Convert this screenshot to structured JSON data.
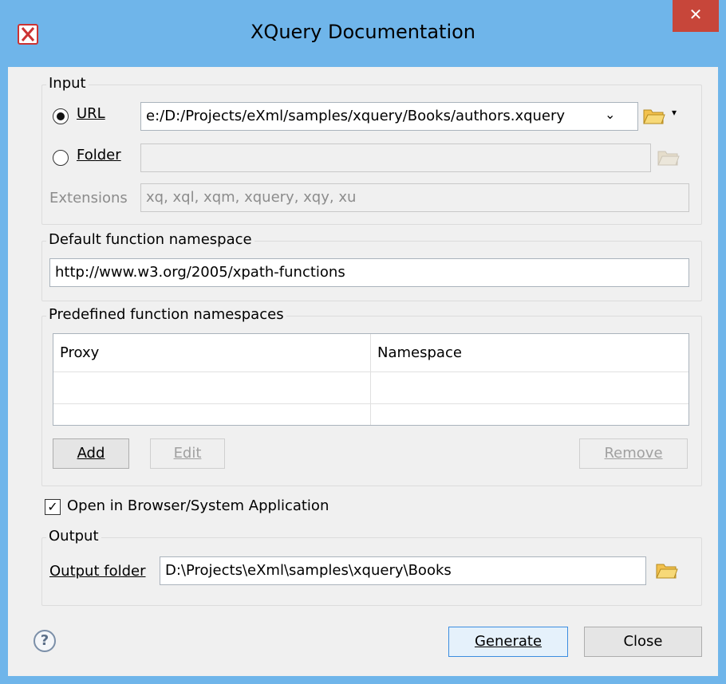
{
  "window": {
    "title": "XQuery Documentation",
    "close_glyph": "✕"
  },
  "input_group": {
    "label": "Input",
    "url_label": "URL",
    "url_value": "e:/D:/Projects/eXml/samples/xquery/Books/authors.xquery",
    "folder_label": "Folder",
    "folder_value": "",
    "extensions_label": "Extensions",
    "extensions_value": "xq, xql, xqm, xquery, xqy, xu"
  },
  "default_ns": {
    "label": "Default function namespace",
    "value": "http://www.w3.org/2005/xpath-functions"
  },
  "predefined_ns": {
    "label": "Predefined function namespaces",
    "columns": [
      "Proxy",
      "Namespace"
    ],
    "rows": [],
    "add_label": "Add",
    "edit_label": "Edit",
    "remove_label": "Remove"
  },
  "open_in_browser": {
    "label": "Open in Browser/System Application",
    "checked": true
  },
  "output_group": {
    "label": "Output",
    "folder_label": "Output folder",
    "folder_value": "D:\\Projects\\eXml\\samples\\xquery\\Books"
  },
  "footer": {
    "help_glyph": "?",
    "generate_label": "Generate",
    "close_label": "Close"
  },
  "colors": {
    "titlebar": "#6fb5ea",
    "close_button": "#c7463a",
    "dialog_background": "#f0f0f0"
  }
}
